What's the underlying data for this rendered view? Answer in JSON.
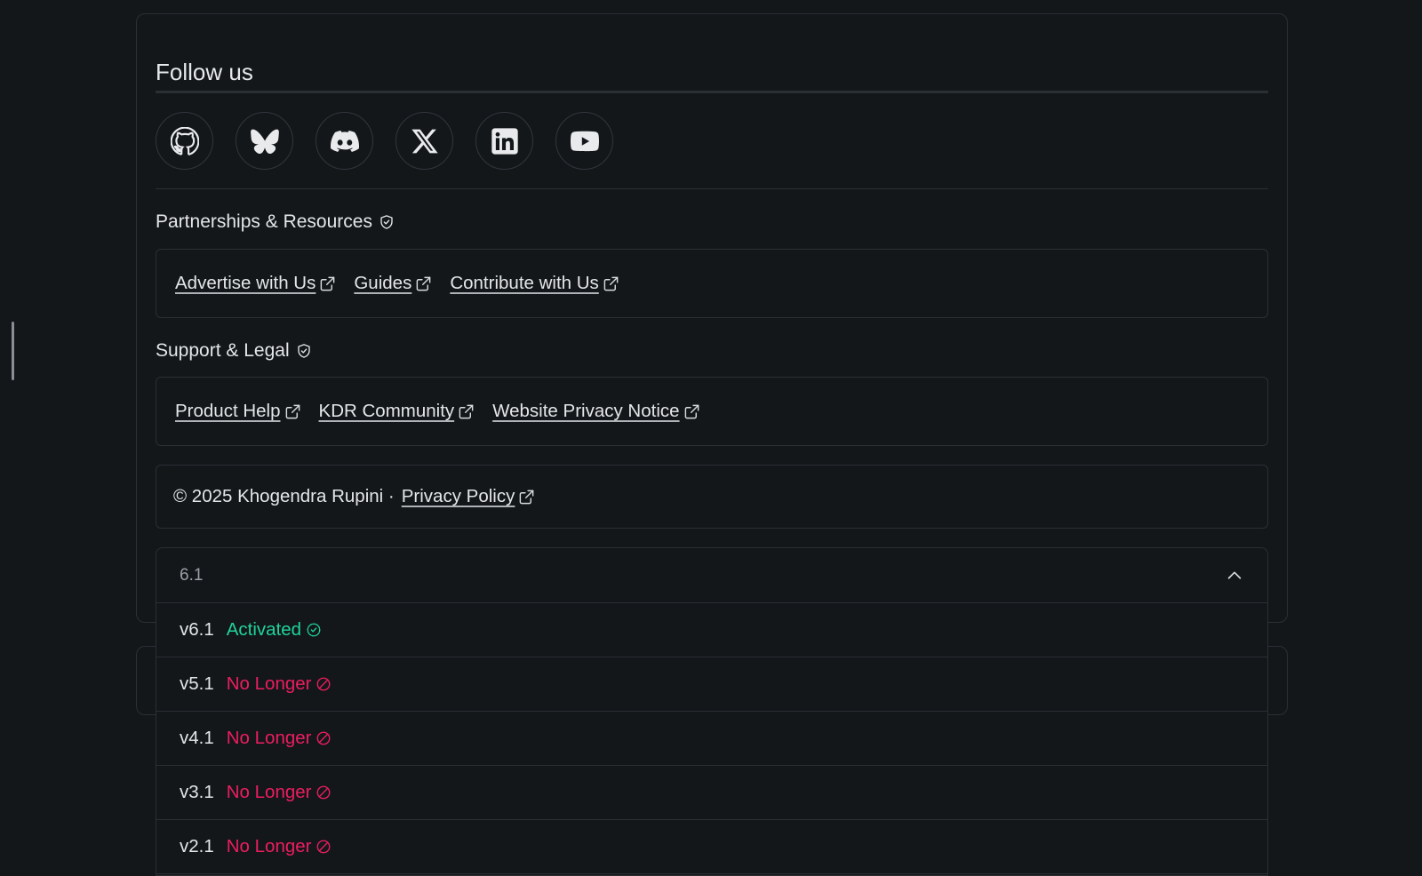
{
  "follow": {
    "title": "Follow us",
    "socials": [
      {
        "icon": "github-icon",
        "name": "github"
      },
      {
        "icon": "bluesky-icon",
        "name": "bluesky"
      },
      {
        "icon": "discord-icon",
        "name": "discord"
      },
      {
        "icon": "x-icon",
        "name": "x"
      },
      {
        "icon": "linkedin-icon",
        "name": "linkedin"
      },
      {
        "icon": "youtube-icon",
        "name": "youtube"
      }
    ]
  },
  "partnerships": {
    "title": "Partnerships & Resources",
    "links": [
      "Advertise with Us",
      "Guides",
      "Contribute with Us"
    ]
  },
  "support": {
    "title": "Support & Legal",
    "links": [
      "Product Help",
      "KDR Community",
      "Website Privacy Notice"
    ]
  },
  "copyright": {
    "text": "© 2025 Khogendra Rupini ·",
    "privacy_link": "Privacy Policy"
  },
  "versions": {
    "current": "6.1",
    "items": [
      {
        "version": "v6.1",
        "status": "Activated"
      },
      {
        "version": "v5.1",
        "status": "No Longer"
      },
      {
        "version": "v4.1",
        "status": "No Longer"
      },
      {
        "version": "v3.1",
        "status": "No Longer"
      },
      {
        "version": "v2.1",
        "status": "No Longer"
      }
    ]
  },
  "colors": {
    "background": "#13171a",
    "border": "#2a2f34",
    "text": "#e4e6e8",
    "activated": "#20d49a",
    "no_longer": "#ec1d5f"
  }
}
